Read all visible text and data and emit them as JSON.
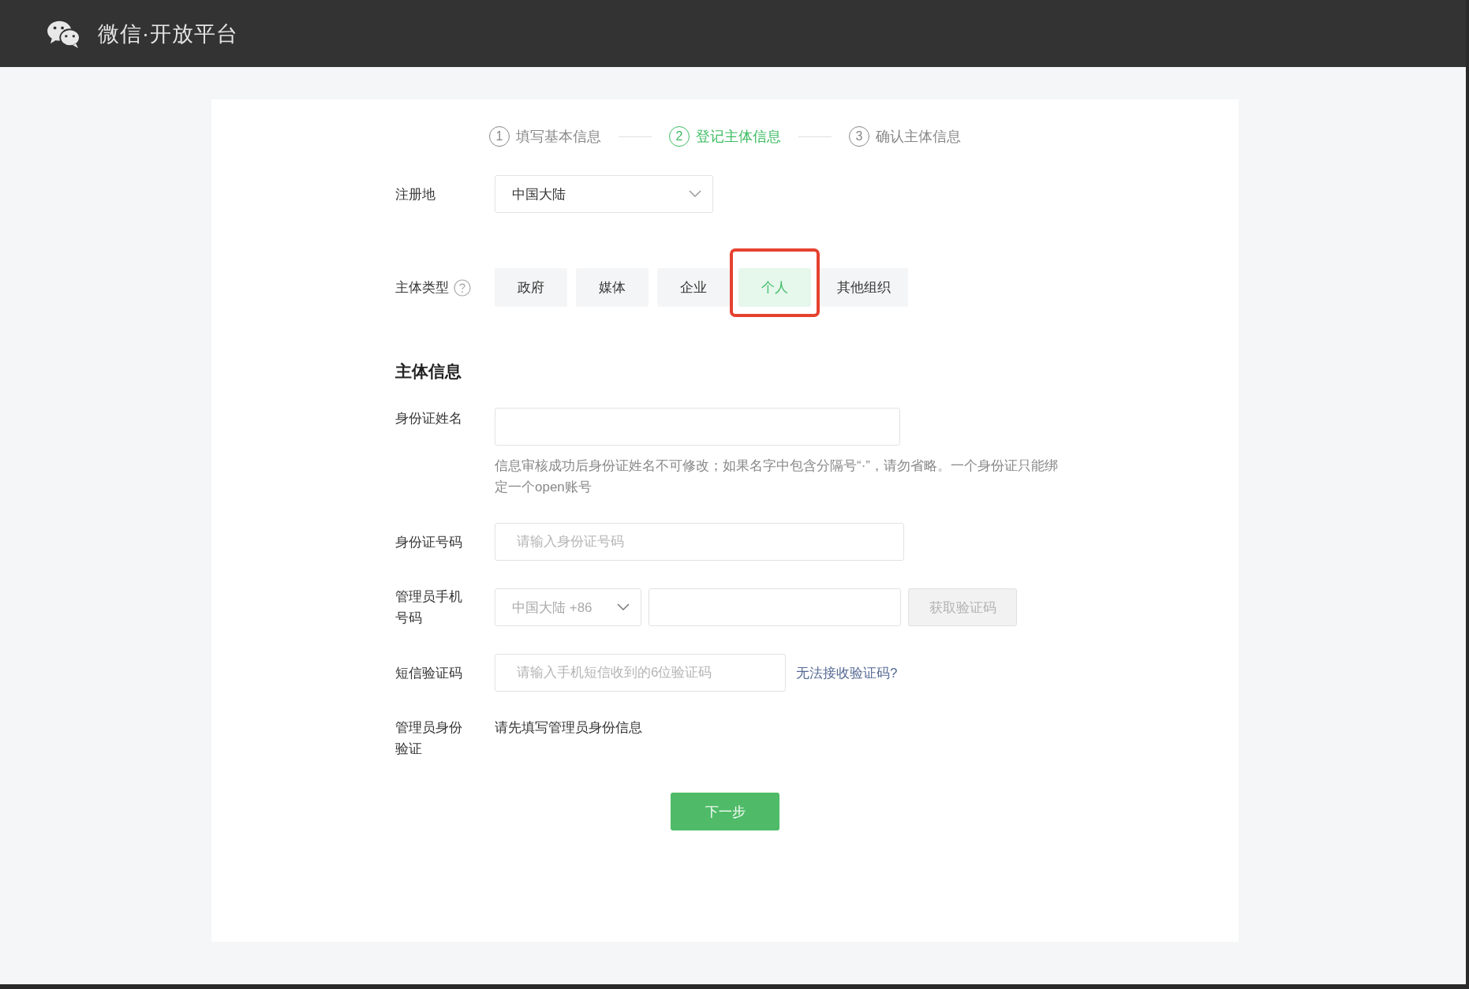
{
  "header": {
    "title": "微信·开放平台"
  },
  "steps": [
    {
      "number": "1",
      "label": "填写基本信息",
      "selected": false
    },
    {
      "number": "2",
      "label": "登记主体信息",
      "selected": true
    },
    {
      "number": "3",
      "label": "确认主体信息",
      "selected": false
    }
  ],
  "form": {
    "region": {
      "label": "注册地",
      "value": "中国大陆"
    },
    "entity_type": {
      "label": "主体类型",
      "options": [
        {
          "label": "政府",
          "selected": false,
          "highlighted": false
        },
        {
          "label": "媒体",
          "selected": false,
          "highlighted": false
        },
        {
          "label": "企业",
          "selected": false,
          "highlighted": false
        },
        {
          "label": "个人",
          "selected": true,
          "highlighted": true
        },
        {
          "label": "其他组织",
          "selected": false,
          "highlighted": false
        }
      ]
    },
    "section_title": "主体信息",
    "id_name": {
      "label": "身份证姓名",
      "hint": "信息审核成功后身份证姓名不可修改；如果名字中包含分隔号“·”，请勿省略。一个身份证只能绑定一个open账号"
    },
    "id_number": {
      "label": "身份证号码",
      "placeholder": "请输入身份证号码"
    },
    "phone": {
      "label": "管理员手机号码",
      "country": "中国大陆 +86",
      "button": "获取验证码",
      "button_disabled": true
    },
    "sms": {
      "label": "短信验证码",
      "placeholder": "请输入手机短信收到的6位验证码",
      "link": "无法接收验证码?"
    },
    "admin_verify": {
      "label": "管理员身份验证",
      "text": "请先填写管理员身份信息"
    },
    "next_button": "下一步"
  }
}
